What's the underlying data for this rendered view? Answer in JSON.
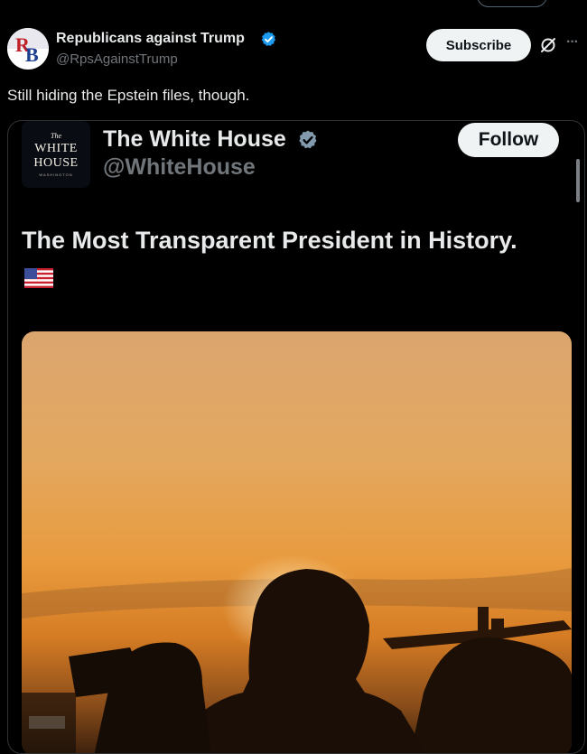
{
  "author": {
    "name": "Republicans against Trump",
    "handle": "@RpsAgainstTrump",
    "avatar_initials": "RB"
  },
  "actions": {
    "subscribe_label": "Subscribe",
    "more_label": "···"
  },
  "tweet": {
    "text": "Still hiding the Epstein files, though."
  },
  "quoted": {
    "logo": {
      "the": "The",
      "white": "WHITE",
      "house": "HOUSE",
      "place": "WASHINGTON"
    },
    "name": "The White House",
    "handle": "@WhiteHouse",
    "follow_label": "Follow",
    "text": "The Most Transparent President in History."
  },
  "colors": {
    "verified_blue": "#1d9bf0",
    "verified_gray": "#829aab",
    "text_primary": "#e7e9ea",
    "text_secondary": "#71767b",
    "border": "#2f3336"
  },
  "icons": [
    "verified-badge-icon",
    "grok-icon",
    "more-icon",
    "us-flag-icon"
  ]
}
